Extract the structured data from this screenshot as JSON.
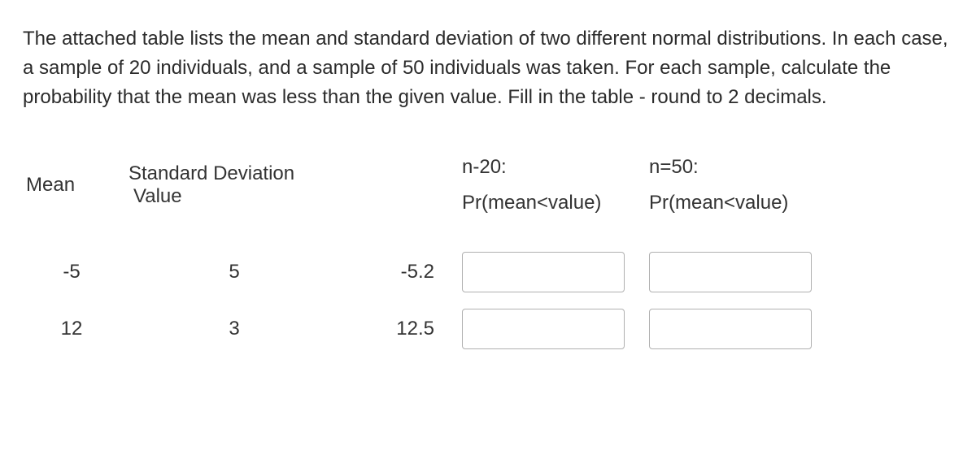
{
  "question": "The attached table lists the mean and standard deviation of two different normal distributions. In each case, a sample of 20 individuals, and a sample of 50 individuals was taken. For each sample, calculate the probability that the mean was less than the given value. Fill in the table - round to 2 decimals.",
  "headers": {
    "mean": "Mean",
    "sd": "Standard Deviation",
    "value": "Value",
    "n20_top": "n-20:",
    "n20_bottom": "Pr(mean<value)",
    "n50_top": "n=50:",
    "n50_bottom": "Pr(mean<value)"
  },
  "rows": [
    {
      "mean": "-5",
      "sd": "5",
      "value": "-5.2",
      "n20": "",
      "n50": ""
    },
    {
      "mean": "12",
      "sd": "3",
      "value": "12.5",
      "n20": "",
      "n50": ""
    }
  ]
}
